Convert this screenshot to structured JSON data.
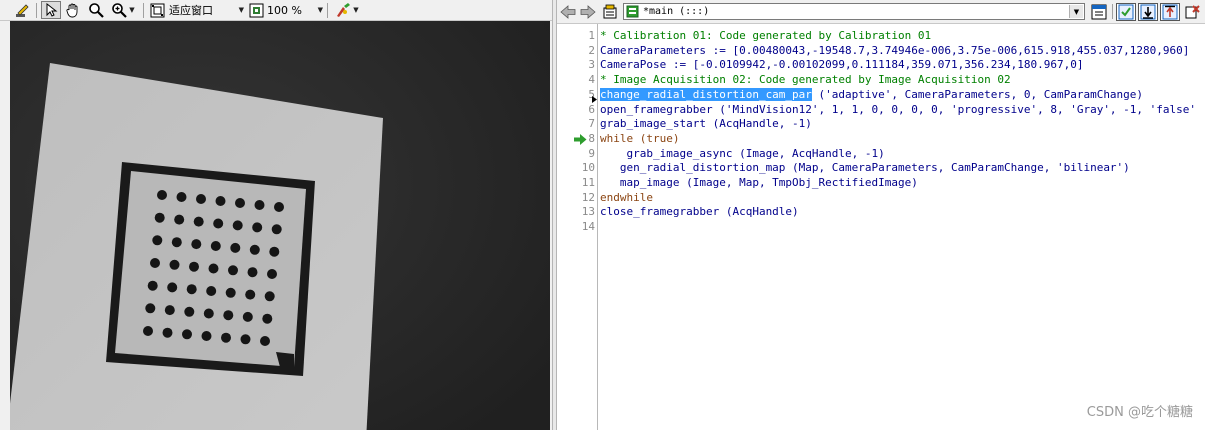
{
  "graphics_toolbar": {
    "zoom_mode": "适应窗口",
    "zoom_percent": "100 %",
    "icons": [
      "pencil-icon",
      "pointer-icon",
      "hand-icon",
      "magnifier-icon",
      "zoom-dropdown-icon",
      "fit-window-icon",
      "zoom-percent-icon",
      "palette-icon"
    ]
  },
  "program_toolbar": {
    "procedure": "*main (:::)",
    "icons": [
      "back-arrow-icon",
      "forward-arrow-icon",
      "program-icon",
      "step-icon",
      "run-icon",
      "step-over-icon",
      "reset-icon",
      "clear-icon"
    ]
  },
  "program": {
    "current_line": 8,
    "breakpoint_line": 5,
    "lines": [
      {
        "n": "1",
        "parts": [
          {
            "t": "* Calibration 01: Code generated by Calibration 01",
            "c": "comment"
          }
        ]
      },
      {
        "n": "2",
        "parts": [
          {
            "t": "CameraParameters := [0.00480043,-19548.7,3.74946e-006,3.75e-006,615.918,455.037,1280,960]",
            "c": "normal"
          }
        ]
      },
      {
        "n": "3",
        "parts": [
          {
            "t": "CameraPose := [-0.0109942,-0.00102099,0.111184,359.071,356.234,180.967,0]",
            "c": "normal"
          }
        ]
      },
      {
        "n": "4",
        "parts": [
          {
            "t": "* Image Acquisition 02: Code generated by Image Acquisition 02",
            "c": "comment"
          }
        ]
      },
      {
        "n": "5",
        "parts": [
          {
            "t": "change_radial_distortion_cam_par",
            "c": "sel"
          },
          {
            "t": " ('adaptive', CameraParameters, 0, CamParamChange)",
            "c": "normal"
          }
        ]
      },
      {
        "n": "6",
        "parts": [
          {
            "t": "open_framegrabber ('MindVision12', 1, 1, 0, 0, 0, 0, 'progressive', 8, 'Gray', -1, 'false'",
            "c": "normal"
          }
        ]
      },
      {
        "n": "7",
        "parts": [
          {
            "t": "grab_image_start (AcqHandle, -1)",
            "c": "normal"
          }
        ]
      },
      {
        "n": "8",
        "parts": [
          {
            "t": "while (true)",
            "c": "ctrl"
          }
        ]
      },
      {
        "n": "9",
        "parts": [
          {
            "t": "    grab_image_async (Image, AcqHandle, -1)",
            "c": "normal"
          }
        ]
      },
      {
        "n": "10",
        "parts": [
          {
            "t": "   gen_radial_distortion_map (Map, CameraParameters, CamParamChange, 'bilinear')",
            "c": "normal"
          }
        ]
      },
      {
        "n": "11",
        "parts": [
          {
            "t": "   map_image (Image, Map, TmpObj_RectifiedImage)",
            "c": "normal"
          }
        ]
      },
      {
        "n": "12",
        "parts": [
          {
            "t": "endwhile",
            "c": "ctrl"
          }
        ]
      },
      {
        "n": "13",
        "parts": [
          {
            "t": "close_framegrabber (AcqHandle)",
            "c": "normal"
          }
        ]
      },
      {
        "n": "14",
        "parts": []
      }
    ]
  },
  "calibration_plate": {
    "rows": 7,
    "cols": 7
  },
  "watermark": "CSDN @吃个糖糖",
  "colors": {
    "comment": "#008000",
    "code": "#00008b",
    "control": "#8b4513",
    "selection": "#3399ff",
    "pc_arrow": "#2e9d2e"
  }
}
